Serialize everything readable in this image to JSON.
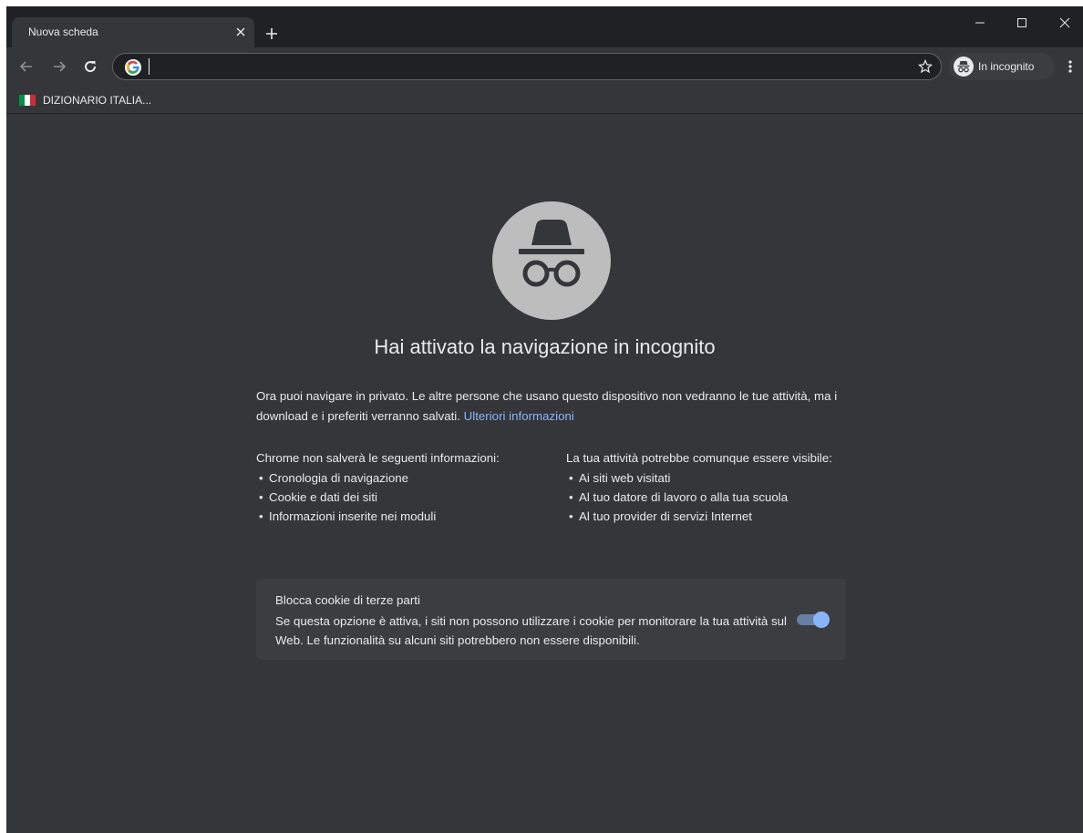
{
  "tab": {
    "title": "Nuova scheda"
  },
  "omnibox": {
    "value": ""
  },
  "profile": {
    "label": "In incognito"
  },
  "bookmarks": [
    {
      "label": "DIZIONARIO ITALIA..."
    }
  ],
  "page": {
    "headline": "Hai attivato la navigazione in incognito",
    "intro": "Ora puoi navigare in privato. Le altre persone che usano questo dispositivo non vedranno le tue attività, ma i download e i preferiti verranno salvati.",
    "learn_more": "Ulteriori informazioni",
    "left_title": "Chrome non salverà le seguenti informazioni:",
    "left_items": [
      "Cronologia di navigazione",
      "Cookie e dati dei siti",
      "Informazioni inserite nei moduli"
    ],
    "right_title": "La tua attività potrebbe comunque essere visibile:",
    "right_items": [
      "Ai siti web visitati",
      "Al tuo datore di lavoro o alla tua scuola",
      "Al tuo provider di servizi Internet"
    ],
    "cookie_card": {
      "title": "Blocca cookie di terze parti",
      "description": "Se questa opzione è attiva, i siti non possono utilizzare i cookie per monitorare la tua attività sul Web. Le funzionalità su alcuni siti potrebbero non essere disponibili.",
      "enabled": true
    }
  },
  "colors": {
    "frame": "#202124",
    "surface": "#35363a",
    "card": "#3c3d41",
    "text": "#e8eaed",
    "link": "#8ab4f8",
    "hero_circle": "#bdbdbd"
  },
  "icons": {
    "tab_close": "close-icon",
    "new_tab": "plus-icon",
    "minimize": "minimize-icon",
    "maximize": "maximize-icon",
    "close_window": "close-icon",
    "back": "arrow-back-icon",
    "forward": "arrow-forward-icon",
    "reload": "reload-icon",
    "google": "google-g-icon",
    "bookmark_star": "star-icon",
    "incognito": "incognito-icon",
    "menu": "kebab-menu-icon",
    "flag": "italian-flag-icon"
  }
}
